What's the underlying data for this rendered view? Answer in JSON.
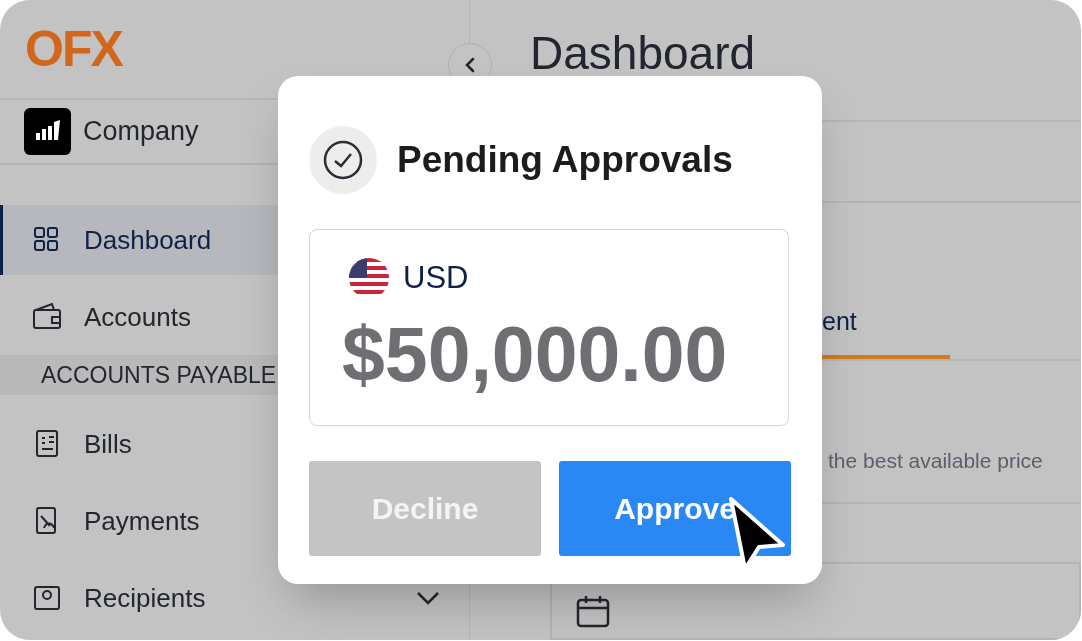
{
  "sidebar": {
    "logo": "OFX",
    "company": "Company",
    "items": [
      {
        "label": "Dashboard",
        "selected": true
      },
      {
        "label": "Accounts",
        "selected": false
      }
    ],
    "section": "ACCOUNTS PAYABLE",
    "section_items": [
      {
        "label": "Bills",
        "selected": false
      },
      {
        "label": "Payments",
        "selected": false
      },
      {
        "label": "Recipients",
        "selected": false,
        "expanded": false
      }
    ]
  },
  "main": {
    "title": "Dashboard",
    "tabs": [
      {
        "label": "ent",
        "selected": true
      }
    ],
    "note": "the best available price"
  },
  "dialog": {
    "title": "Pending Approvals",
    "currency": "USD",
    "amount": "$50,000.00",
    "buttons": [
      {
        "label": "Decline",
        "kind": "secondary"
      },
      {
        "label": "Approve",
        "kind": "primary"
      }
    ]
  }
}
